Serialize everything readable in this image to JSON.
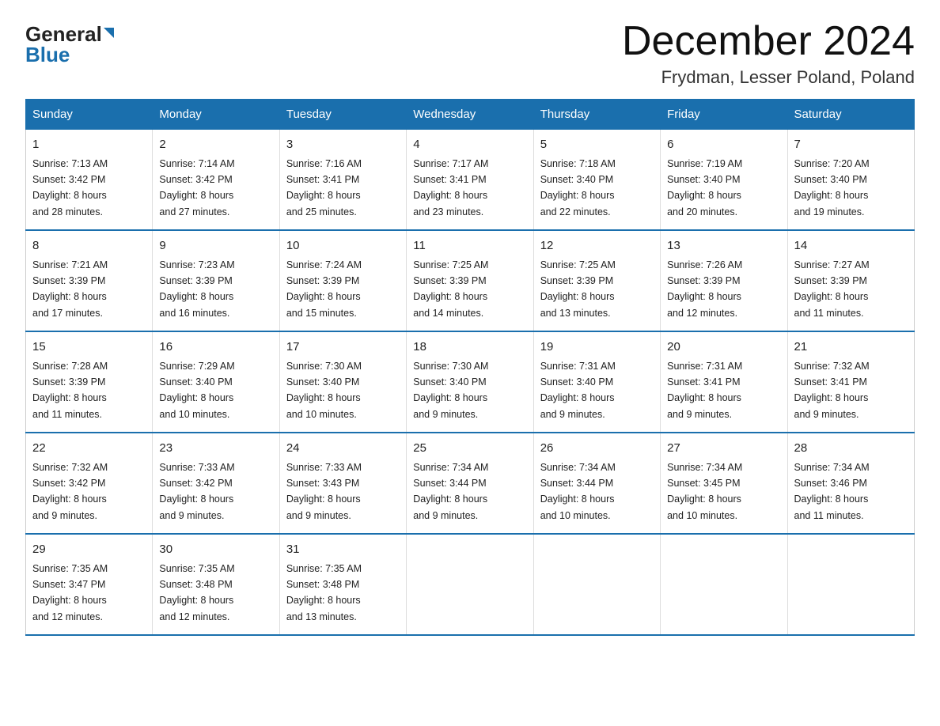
{
  "logo": {
    "general": "General",
    "arrow": "",
    "blue": "Blue"
  },
  "title": "December 2024",
  "subtitle": "Frydman, Lesser Poland, Poland",
  "days_of_week": [
    "Sunday",
    "Monday",
    "Tuesday",
    "Wednesday",
    "Thursday",
    "Friday",
    "Saturday"
  ],
  "weeks": [
    [
      {
        "day": "1",
        "sunrise": "7:13 AM",
        "sunset": "3:42 PM",
        "daylight": "8 hours and 28 minutes."
      },
      {
        "day": "2",
        "sunrise": "7:14 AM",
        "sunset": "3:42 PM",
        "daylight": "8 hours and 27 minutes."
      },
      {
        "day": "3",
        "sunrise": "7:16 AM",
        "sunset": "3:41 PM",
        "daylight": "8 hours and 25 minutes."
      },
      {
        "day": "4",
        "sunrise": "7:17 AM",
        "sunset": "3:41 PM",
        "daylight": "8 hours and 23 minutes."
      },
      {
        "day": "5",
        "sunrise": "7:18 AM",
        "sunset": "3:40 PM",
        "daylight": "8 hours and 22 minutes."
      },
      {
        "day": "6",
        "sunrise": "7:19 AM",
        "sunset": "3:40 PM",
        "daylight": "8 hours and 20 minutes."
      },
      {
        "day": "7",
        "sunrise": "7:20 AM",
        "sunset": "3:40 PM",
        "daylight": "8 hours and 19 minutes."
      }
    ],
    [
      {
        "day": "8",
        "sunrise": "7:21 AM",
        "sunset": "3:39 PM",
        "daylight": "8 hours and 17 minutes."
      },
      {
        "day": "9",
        "sunrise": "7:23 AM",
        "sunset": "3:39 PM",
        "daylight": "8 hours and 16 minutes."
      },
      {
        "day": "10",
        "sunrise": "7:24 AM",
        "sunset": "3:39 PM",
        "daylight": "8 hours and 15 minutes."
      },
      {
        "day": "11",
        "sunrise": "7:25 AM",
        "sunset": "3:39 PM",
        "daylight": "8 hours and 14 minutes."
      },
      {
        "day": "12",
        "sunrise": "7:25 AM",
        "sunset": "3:39 PM",
        "daylight": "8 hours and 13 minutes."
      },
      {
        "day": "13",
        "sunrise": "7:26 AM",
        "sunset": "3:39 PM",
        "daylight": "8 hours and 12 minutes."
      },
      {
        "day": "14",
        "sunrise": "7:27 AM",
        "sunset": "3:39 PM",
        "daylight": "8 hours and 11 minutes."
      }
    ],
    [
      {
        "day": "15",
        "sunrise": "7:28 AM",
        "sunset": "3:39 PM",
        "daylight": "8 hours and 11 minutes."
      },
      {
        "day": "16",
        "sunrise": "7:29 AM",
        "sunset": "3:40 PM",
        "daylight": "8 hours and 10 minutes."
      },
      {
        "day": "17",
        "sunrise": "7:30 AM",
        "sunset": "3:40 PM",
        "daylight": "8 hours and 10 minutes."
      },
      {
        "day": "18",
        "sunrise": "7:30 AM",
        "sunset": "3:40 PM",
        "daylight": "8 hours and 9 minutes."
      },
      {
        "day": "19",
        "sunrise": "7:31 AM",
        "sunset": "3:40 PM",
        "daylight": "8 hours and 9 minutes."
      },
      {
        "day": "20",
        "sunrise": "7:31 AM",
        "sunset": "3:41 PM",
        "daylight": "8 hours and 9 minutes."
      },
      {
        "day": "21",
        "sunrise": "7:32 AM",
        "sunset": "3:41 PM",
        "daylight": "8 hours and 9 minutes."
      }
    ],
    [
      {
        "day": "22",
        "sunrise": "7:32 AM",
        "sunset": "3:42 PM",
        "daylight": "8 hours and 9 minutes."
      },
      {
        "day": "23",
        "sunrise": "7:33 AM",
        "sunset": "3:42 PM",
        "daylight": "8 hours and 9 minutes."
      },
      {
        "day": "24",
        "sunrise": "7:33 AM",
        "sunset": "3:43 PM",
        "daylight": "8 hours and 9 minutes."
      },
      {
        "day": "25",
        "sunrise": "7:34 AM",
        "sunset": "3:44 PM",
        "daylight": "8 hours and 9 minutes."
      },
      {
        "day": "26",
        "sunrise": "7:34 AM",
        "sunset": "3:44 PM",
        "daylight": "8 hours and 10 minutes."
      },
      {
        "day": "27",
        "sunrise": "7:34 AM",
        "sunset": "3:45 PM",
        "daylight": "8 hours and 10 minutes."
      },
      {
        "day": "28",
        "sunrise": "7:34 AM",
        "sunset": "3:46 PM",
        "daylight": "8 hours and 11 minutes."
      }
    ],
    [
      {
        "day": "29",
        "sunrise": "7:35 AM",
        "sunset": "3:47 PM",
        "daylight": "8 hours and 12 minutes."
      },
      {
        "day": "30",
        "sunrise": "7:35 AM",
        "sunset": "3:48 PM",
        "daylight": "8 hours and 12 minutes."
      },
      {
        "day": "31",
        "sunrise": "7:35 AM",
        "sunset": "3:48 PM",
        "daylight": "8 hours and 13 minutes."
      },
      null,
      null,
      null,
      null
    ]
  ],
  "labels": {
    "sunrise": "Sunrise:",
    "sunset": "Sunset:",
    "daylight": "Daylight:"
  }
}
